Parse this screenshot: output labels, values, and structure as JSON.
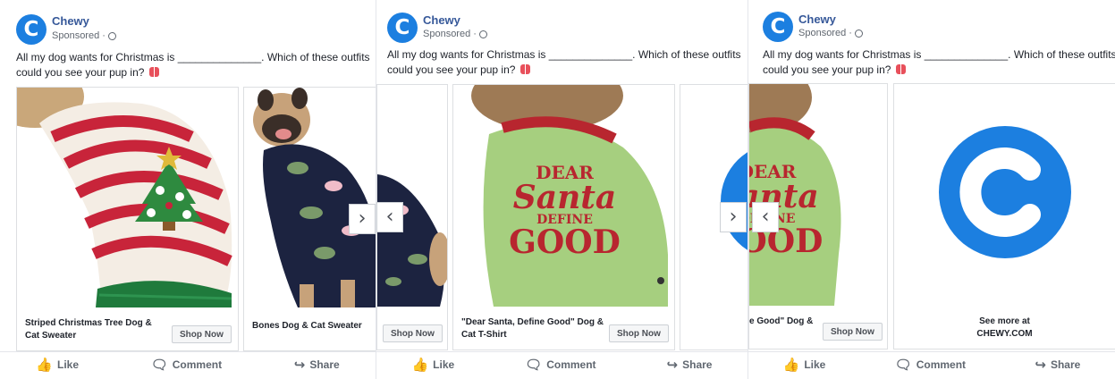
{
  "ad": {
    "brand": "Chewy",
    "logo_letter": "C",
    "sponsored": "Sponsored ·",
    "caption_line1": "All my dog wants for Christmas is ______________. Which of these outfits",
    "caption_line2": "could you see your pup in?",
    "brand_color": "#1c7fe0",
    "link_color": "#365899"
  },
  "cards": {
    "striped": {
      "title_line1": "Striped Christmas Tree Dog &",
      "title_line2": "Cat Sweater",
      "cta": "Shop Now"
    },
    "bones": {
      "title_line1": "Bones Dog & Cat Sweater",
      "cta": "Shop Now"
    },
    "santa": {
      "title_line1": "\"Dear Santa, Define Good\" Dog &",
      "title_line2": "Cat T-Shirt",
      "cta": "Shop Now",
      "fragment": "e Good\" Dog &"
    },
    "see_more": {
      "line1": "See more at",
      "line2": "CHEWY.COM"
    }
  },
  "shirt_print": {
    "line1": "DEAR",
    "line2": "Santa",
    "line3": "DEFINE",
    "line4": "GOOD"
  },
  "nav": {
    "next": "›",
    "prev": "‹"
  },
  "actions": {
    "like": "Like",
    "comment": "Comment",
    "share": "Share"
  },
  "icons": [
    "chewy-logo-icon",
    "globe-icon",
    "gift-icon",
    "like-icon",
    "comment-icon",
    "share-icon",
    "chevron-left-icon",
    "chevron-right-icon"
  ]
}
